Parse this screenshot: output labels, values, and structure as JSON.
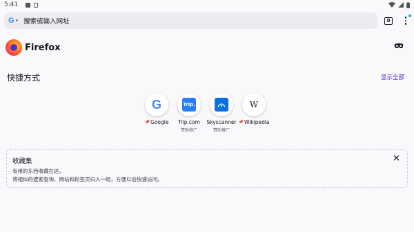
{
  "status_bar": {
    "time": "5:41"
  },
  "toolbar": {
    "engine_letter": "G",
    "search_placeholder": "搜索或输入网址",
    "tab_count": "0"
  },
  "header": {
    "brand": "Firefox"
  },
  "shortcuts": {
    "title": "快捷方式",
    "show_all": "显示全部",
    "items": [
      {
        "label": "Google",
        "sublabel": "",
        "pinned": true
      },
      {
        "label": "Trip.com",
        "sublabel": "赞助推广",
        "pinned": false,
        "icon_text": "Trip."
      },
      {
        "label": "Skyscanner",
        "sublabel": "赞助推广",
        "pinned": false
      },
      {
        "label": "Wikipedia",
        "sublabel": "",
        "pinned": true,
        "icon_text": "W"
      }
    ]
  },
  "collections": {
    "title": "收藏集",
    "line1": "有用的东西收藏在这。",
    "line2": "将相似的搜索查询、网站和标签页归入一组，方便以后快速访问。"
  },
  "colors": {
    "accent": "#592acb",
    "tab_badge": "#00b3f4",
    "background": "#f9f9fb"
  }
}
